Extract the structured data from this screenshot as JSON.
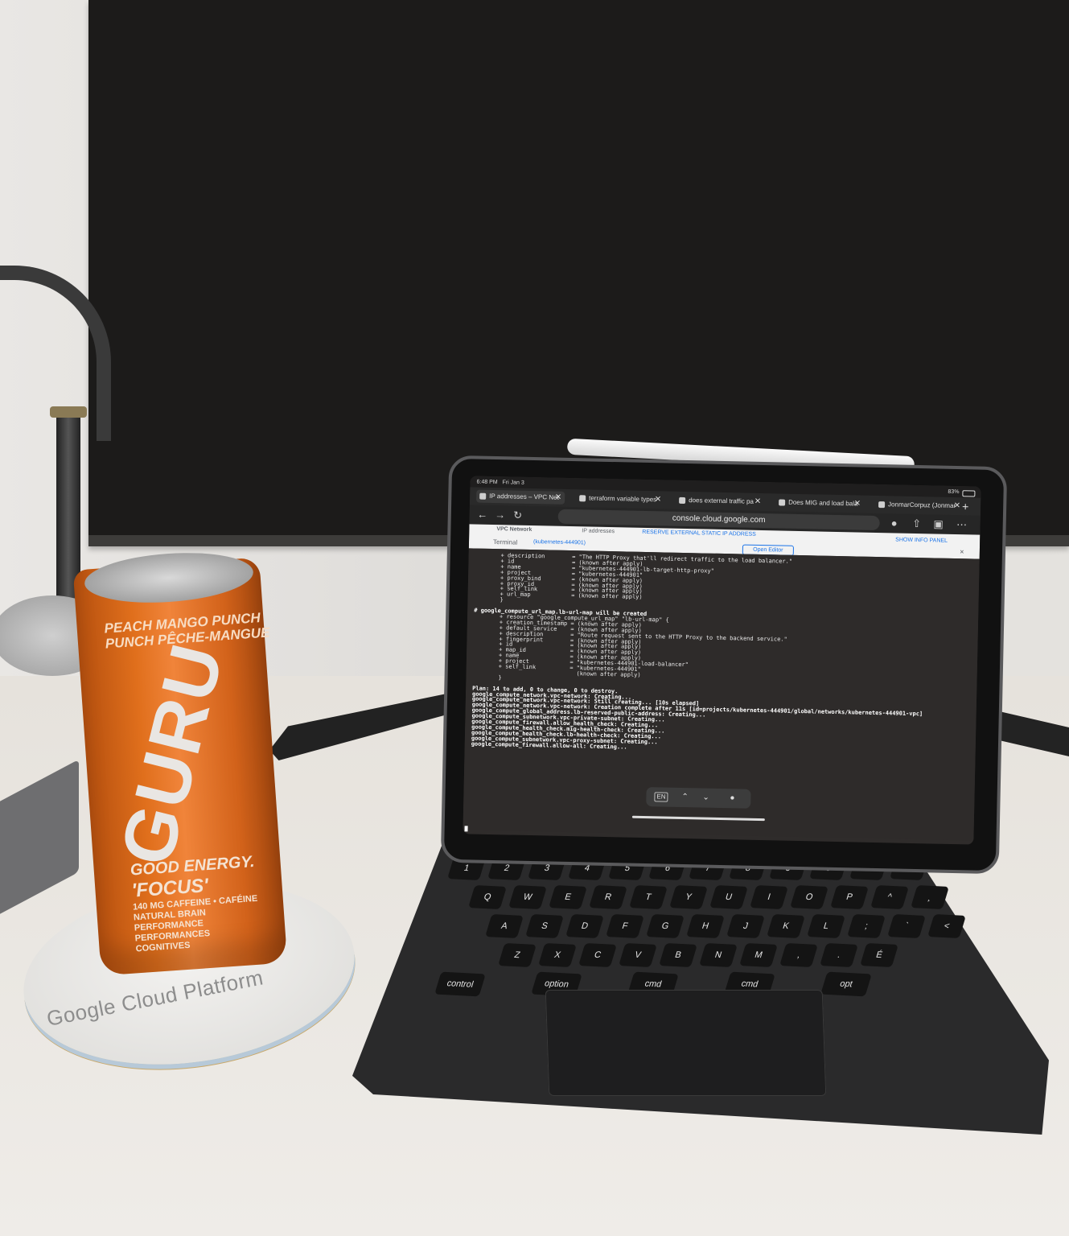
{
  "scene": {
    "can": {
      "flavour_line1": "PEACH MANGO PUNCH",
      "flavour_line2": "PUNCH PÊCHE-MANGUE",
      "brand": "GURU",
      "tagline": "GOOD ENERGY.",
      "variant": "'FOCUS'",
      "line1": "140 MG CAFFEINE • CAFÉINE",
      "line2": "NATURAL BRAIN PERFORMANCE",
      "line3": "PERFORMANCES COGNITIVES"
    },
    "coaster": {
      "text": "Google Cloud Platform"
    }
  },
  "ipad": {
    "status": {
      "time": "6:48 PM",
      "date": "Fri Jan 3",
      "battery": "83%"
    },
    "tabs": [
      {
        "label": "IP addresses – VPC Net",
        "active": true
      },
      {
        "label": "terraform variable types",
        "active": false
      },
      {
        "label": "does external traffic pa",
        "active": false
      },
      {
        "label": "Does MIG and load bala",
        "active": false
      },
      {
        "label": "JonmarCorpuz (Jonmar",
        "active": false
      }
    ],
    "address": "console.cloud.google.com",
    "console": {
      "breadcrumb": "VPC Network",
      "page": "IP addresses",
      "action": "RESERVE EXTERNAL STATIC IP ADDRESS",
      "terminal_label": "Terminal",
      "session_tab": "(kubernetes-444901)",
      "open_editor": "Open Editor",
      "info_panel": "SHOW INFO PANEL"
    },
    "terminal_lines": [
      "+ description        = \"The HTTP Proxy that'll redirect traffic to the load balancer.\"",
      "+ id                 = (known after apply)",
      "+ name               = \"kubernetes-444901-lb-target-http-proxy\"",
      "+ project            = \"kubernetes-444901\"",
      "+ proxy_bind         = (known after apply)",
      "+ proxy_id           = (known after apply)",
      "+ self_link          = (known after apply)",
      "+ url_map            = (known after apply)",
      "}",
      "",
      "# google_compute_url_map.lb-url-map will be created",
      "+ resource \"google_compute_url_map\" \"lb-url-map\" {",
      "+ creation_timestamp = (known after apply)",
      "+ default_service    = (known after apply)",
      "+ description        = \"Route request sent to the HTTP Proxy to the backend service.\"",
      "+ fingerprint        = (known after apply)",
      "+ id                 = (known after apply)",
      "+ map_id             = (known after apply)",
      "+ name               = (known after apply)",
      "+ project            = \"kubernetes-444901-load-balancer\"",
      "+ self_link          = \"kubernetes-444901\"",
      "                       (known after apply)",
      "}",
      "",
      "Plan: 14 to add, 0 to change, 0 to destroy.",
      "google_compute_network.vpc-network: Creating...",
      "google_compute_network.vpc-network: Still creating... [10s elapsed]",
      "google_compute_network.vpc-network: Creation complete after 11s [id=projects/kubernetes-444901/global/networks/kubernetes-444901-vpc]",
      "google_compute_global_address.lb-reserved-public-address: Creating...",
      "google_compute_subnetwork.vpc-private-subnet: Creating...",
      "google_compute_firewall.allow_health_check: Creating...",
      "google_compute_health_check.mig-health-check: Creating...",
      "google_compute_health_check.lb-health-check: Creating...",
      "google_compute_subnetwork.vpc-proxy-subnet: Creating...",
      "google_compute_firewall.allow-all: Creating..."
    ],
    "shortcut_bar": {
      "lang": "EN"
    }
  },
  "keyboard": {
    "rows": [
      [
        "1",
        "2",
        "3",
        "4",
        "5",
        "6",
        "7",
        "8",
        "9",
        "0",
        "-",
        "="
      ],
      [
        "Q",
        "W",
        "E",
        "R",
        "T",
        "Y",
        "U",
        "I",
        "O",
        "P",
        "^",
        "¸"
      ],
      [
        "A",
        "S",
        "D",
        "F",
        "G",
        "H",
        "J",
        "K",
        "L",
        ";",
        "`",
        "<"
      ],
      [
        "Z",
        "X",
        "C",
        "V",
        "B",
        "N",
        "M",
        ",",
        ".",
        "É"
      ],
      [
        "control",
        "option",
        "cmd",
        "cmd",
        "opt"
      ]
    ]
  }
}
